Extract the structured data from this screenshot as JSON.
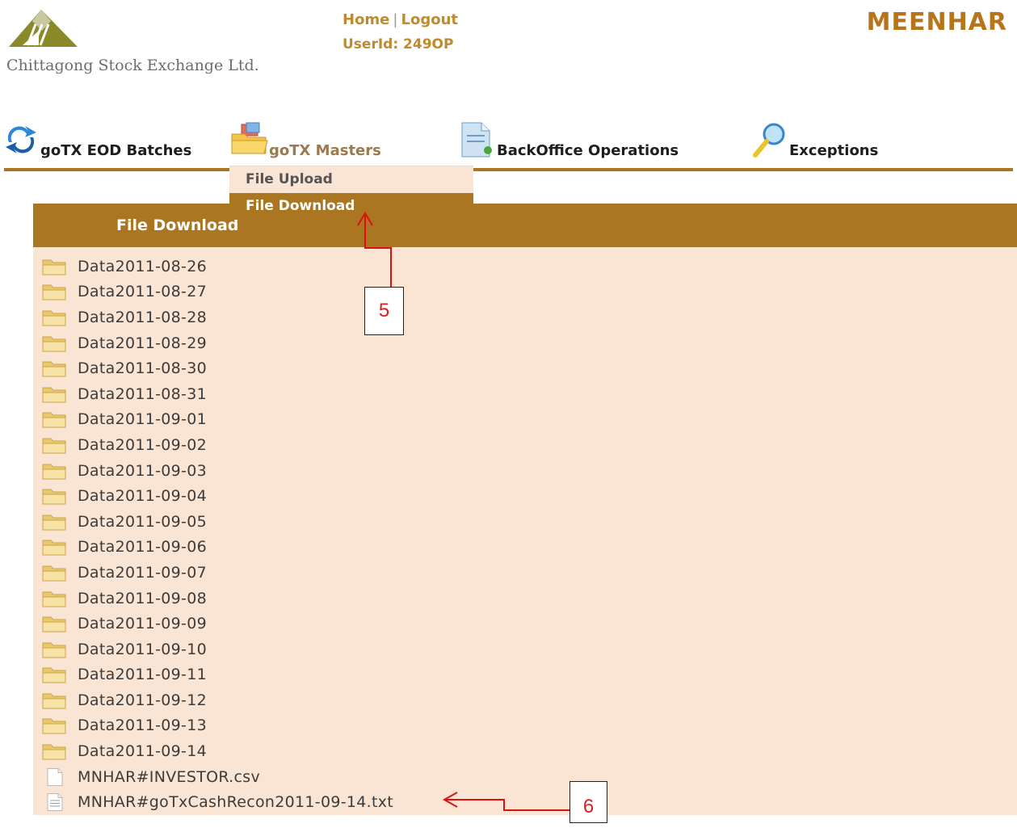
{
  "header": {
    "logo_text": "Chittagong Stock Exchange Ltd.",
    "home_link": "Home",
    "separator": "|",
    "logout_link": "Logout",
    "userid": "UserId: 249OP",
    "brand": "MEENHAR"
  },
  "nav": {
    "items": [
      {
        "label": "goTX EOD Batches",
        "icon": "refresh-arrows-icon"
      },
      {
        "label": "goTX Masters",
        "icon": "folder-stack-icon"
      },
      {
        "label": "BackOffice Operations",
        "icon": "document-icon"
      },
      {
        "label": "Exceptions",
        "icon": "magnifier-icon"
      }
    ]
  },
  "dropdown": {
    "items": [
      {
        "label": "File Upload"
      },
      {
        "label": "File Download"
      }
    ],
    "selected": "File Download"
  },
  "panel": {
    "title": "File Download"
  },
  "files": [
    {
      "name": "Data2011-08-26",
      "type": "folder"
    },
    {
      "name": "Data2011-08-27",
      "type": "folder"
    },
    {
      "name": "Data2011-08-28",
      "type": "folder"
    },
    {
      "name": "Data2011-08-29",
      "type": "folder"
    },
    {
      "name": "Data2011-08-30",
      "type": "folder"
    },
    {
      "name": "Data2011-08-31",
      "type": "folder"
    },
    {
      "name": "Data2011-09-01",
      "type": "folder"
    },
    {
      "name": "Data2011-09-02",
      "type": "folder"
    },
    {
      "name": "Data2011-09-03",
      "type": "folder"
    },
    {
      "name": "Data2011-09-04",
      "type": "folder"
    },
    {
      "name": "Data2011-09-05",
      "type": "folder"
    },
    {
      "name": "Data2011-09-06",
      "type": "folder"
    },
    {
      "name": "Data2011-09-07",
      "type": "folder"
    },
    {
      "name": "Data2011-09-08",
      "type": "folder"
    },
    {
      "name": "Data2011-09-09",
      "type": "folder"
    },
    {
      "name": "Data2011-09-10",
      "type": "folder"
    },
    {
      "name": "Data2011-09-11",
      "type": "folder"
    },
    {
      "name": "Data2011-09-12",
      "type": "folder"
    },
    {
      "name": "Data2011-09-13",
      "type": "folder"
    },
    {
      "name": "Data2011-09-14",
      "type": "folder"
    },
    {
      "name": "MNHAR#INVESTOR.csv",
      "type": "file"
    },
    {
      "name": "MNHAR#goTxCashRecon2011-09-14.txt",
      "type": "text-file"
    }
  ],
  "annotations": {
    "callout_5": "5",
    "callout_6": "6",
    "arrow_color": "#e01010"
  },
  "colors": {
    "accent": "#ab7622",
    "panel_bg": "#fae4d3",
    "link": "#c08a2e",
    "brand": "#b8741a"
  }
}
